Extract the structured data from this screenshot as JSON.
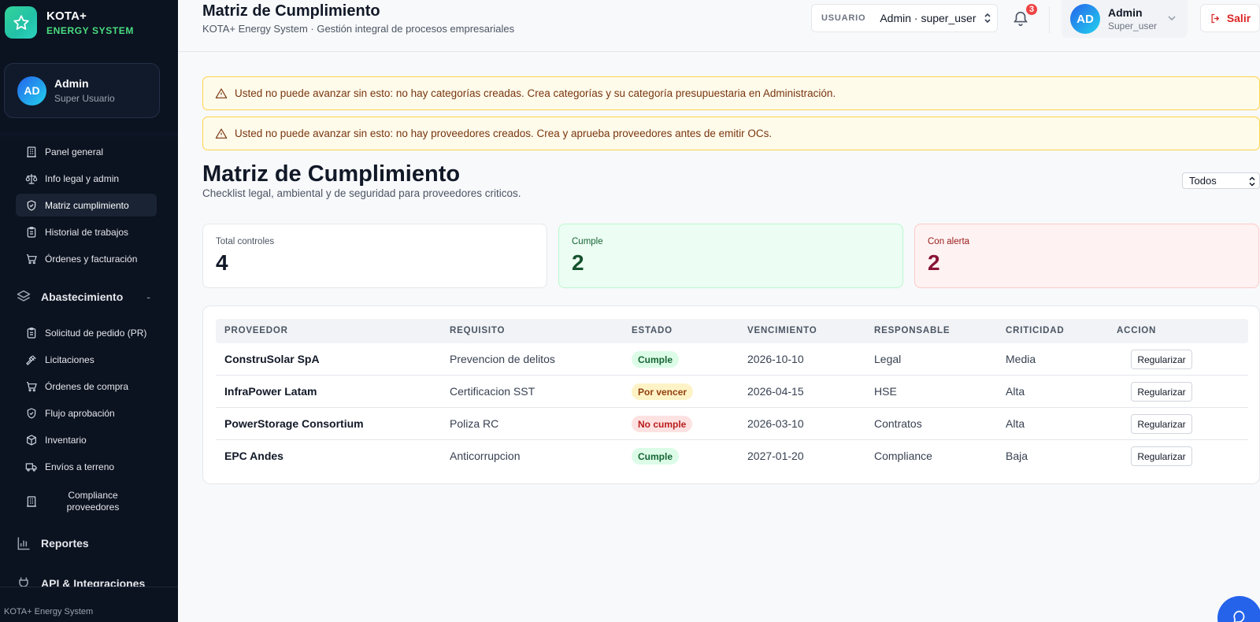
{
  "brand": {
    "name": "KOTA+",
    "tagline": "ENERGY SYSTEM"
  },
  "sidebar_user": {
    "initials": "AD",
    "name": "Admin",
    "role": "Super Usuario"
  },
  "nav": {
    "items_top": [
      {
        "label": "Panel general",
        "icon": "building-icon"
      },
      {
        "label": "Info legal y admin",
        "icon": "scale-icon"
      },
      {
        "label": "Matriz cumplimiento",
        "icon": "shield-check-icon",
        "active": true
      },
      {
        "label": "Historial de trabajos",
        "icon": "clipboard-icon"
      },
      {
        "label": "Órdenes y facturación",
        "icon": "cart-icon"
      }
    ],
    "section_supply": {
      "label": "Abastecimiento",
      "toggle": "-"
    },
    "items_supply": [
      {
        "label": "Solicitud de pedido (PR)",
        "icon": "clipboard-icon"
      },
      {
        "label": "Licitaciones",
        "icon": "gavel-icon"
      },
      {
        "label": "Órdenes de compra",
        "icon": "cart-icon"
      },
      {
        "label": "Flujo aprobación",
        "icon": "shield-check-icon"
      },
      {
        "label": "Inventario",
        "icon": "box-icon"
      },
      {
        "label": "Envíos a terreno",
        "icon": "truck-icon"
      },
      {
        "label": "Compliance proveedores",
        "icon": "building-icon"
      }
    ],
    "section_reports": {
      "label": "Reportes"
    },
    "section_api": {
      "label": "API & Integraciones"
    }
  },
  "sidebar_footer": "KOTA+ Energy System",
  "header": {
    "title": "Matriz de Cumplimiento",
    "subtitle": "KOTA+ Energy System · Gestión integral de procesos empresariales",
    "user_select_label": "USUARIO",
    "user_select_value": "Admin · super_user",
    "notification_count": "3",
    "profile": {
      "initials": "AD",
      "name": "Admin",
      "role": "Super_user"
    },
    "logout_label": "Salir"
  },
  "alerts": [
    "Usted no puede avanzar sin esto: no hay categorías creadas. Crea categorías y su categoría presupuestaria en Administración.",
    "Usted no puede avanzar sin esto: no hay proveedores creados. Crea y aprueba proveedores antes de emitir OCs."
  ],
  "page": {
    "title": "Matriz de Cumplimiento",
    "subtitle": "Checklist legal, ambiental y de seguridad para proveedores criticos.",
    "filter_value": "Todos"
  },
  "stats": [
    {
      "label": "Total controles",
      "value": "4"
    },
    {
      "label": "Cumple",
      "value": "2"
    },
    {
      "label": "Con alerta",
      "value": "2"
    }
  ],
  "table": {
    "headers": [
      "PROVEEDOR",
      "REQUISITO",
      "ESTADO",
      "VENCIMIENTO",
      "RESPONSABLE",
      "CRITICIDAD",
      "ACCION"
    ],
    "rows": [
      {
        "proveedor": "ConstruSolar SpA",
        "requisito": "Prevencion de delitos",
        "estado": "Cumple",
        "vencimiento": "2026-10-10",
        "responsable": "Legal",
        "criticidad": "Media",
        "accion": "Regularizar"
      },
      {
        "proveedor": "InfraPower Latam",
        "requisito": "Certificacion SST",
        "estado": "Por vencer",
        "vencimiento": "2026-04-15",
        "responsable": "HSE",
        "criticidad": "Alta",
        "accion": "Regularizar"
      },
      {
        "proveedor": "PowerStorage Consortium",
        "requisito": "Poliza RC",
        "estado": "No cumple",
        "vencimiento": "2026-03-10",
        "responsable": "Contratos",
        "criticidad": "Alta",
        "accion": "Regularizar"
      },
      {
        "proveedor": "EPC Andes",
        "requisito": "Anticorrupcion",
        "estado": "Cumple",
        "vencimiento": "2027-01-20",
        "responsable": "Compliance",
        "criticidad": "Baja",
        "accion": "Regularizar"
      }
    ]
  },
  "colors": {
    "sidebar_bg": "#0b1220",
    "accent_green": "#4ade80",
    "danger": "#dc2626",
    "primary": "#2563eb"
  }
}
